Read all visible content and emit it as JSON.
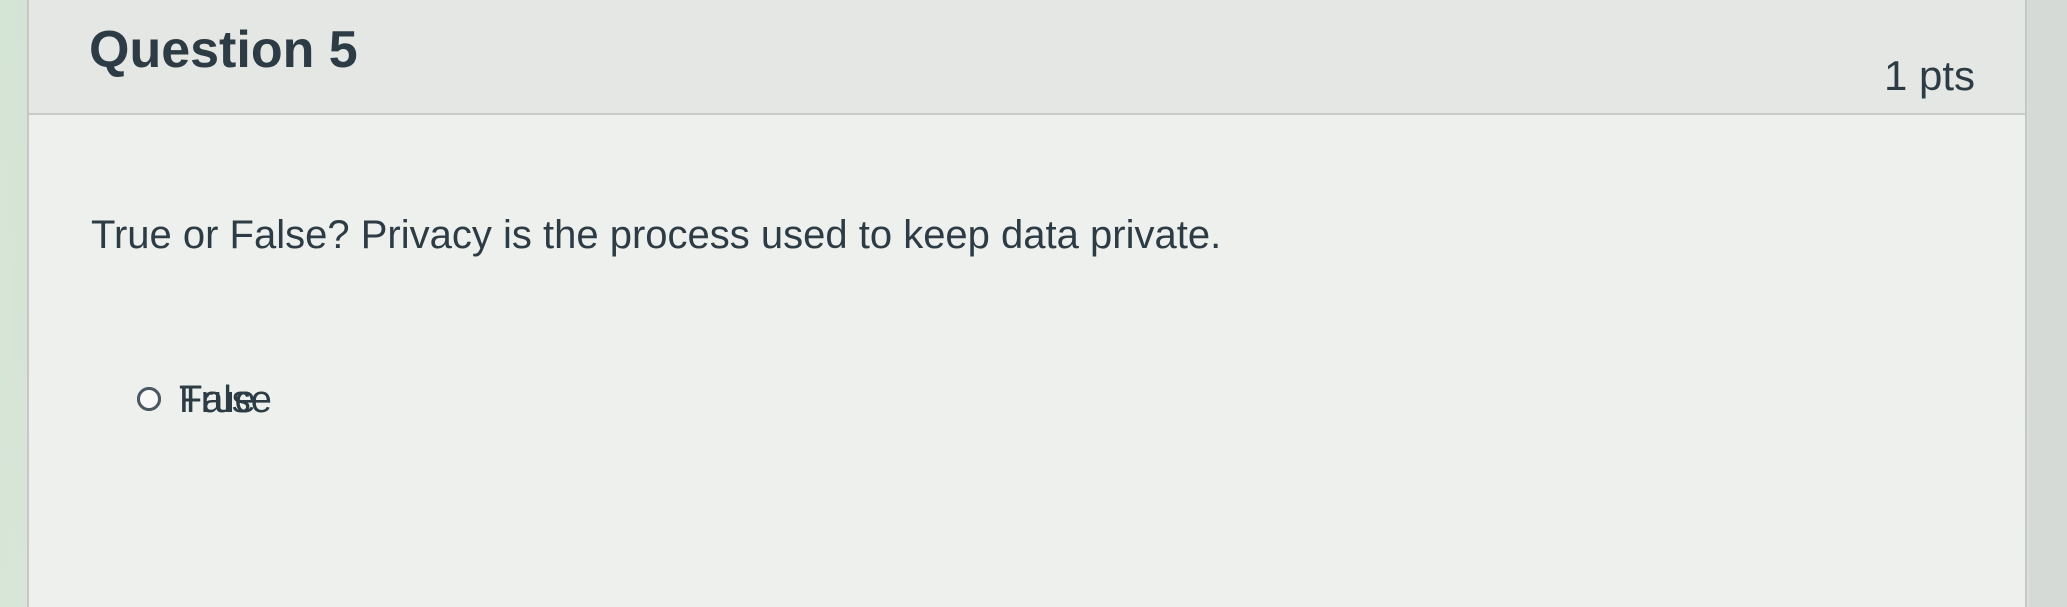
{
  "question": {
    "title": "Question 5",
    "points": "1 pts",
    "prompt": "True or False? Privacy is the process used to keep data private."
  },
  "answers": [
    {
      "label": "True"
    },
    {
      "label": "False"
    }
  ],
  "colors": {
    "text": "#2d3b45",
    "header_background": "#e4e7e4",
    "body_background": "#edf0ed",
    "border": "#c6cac8"
  }
}
